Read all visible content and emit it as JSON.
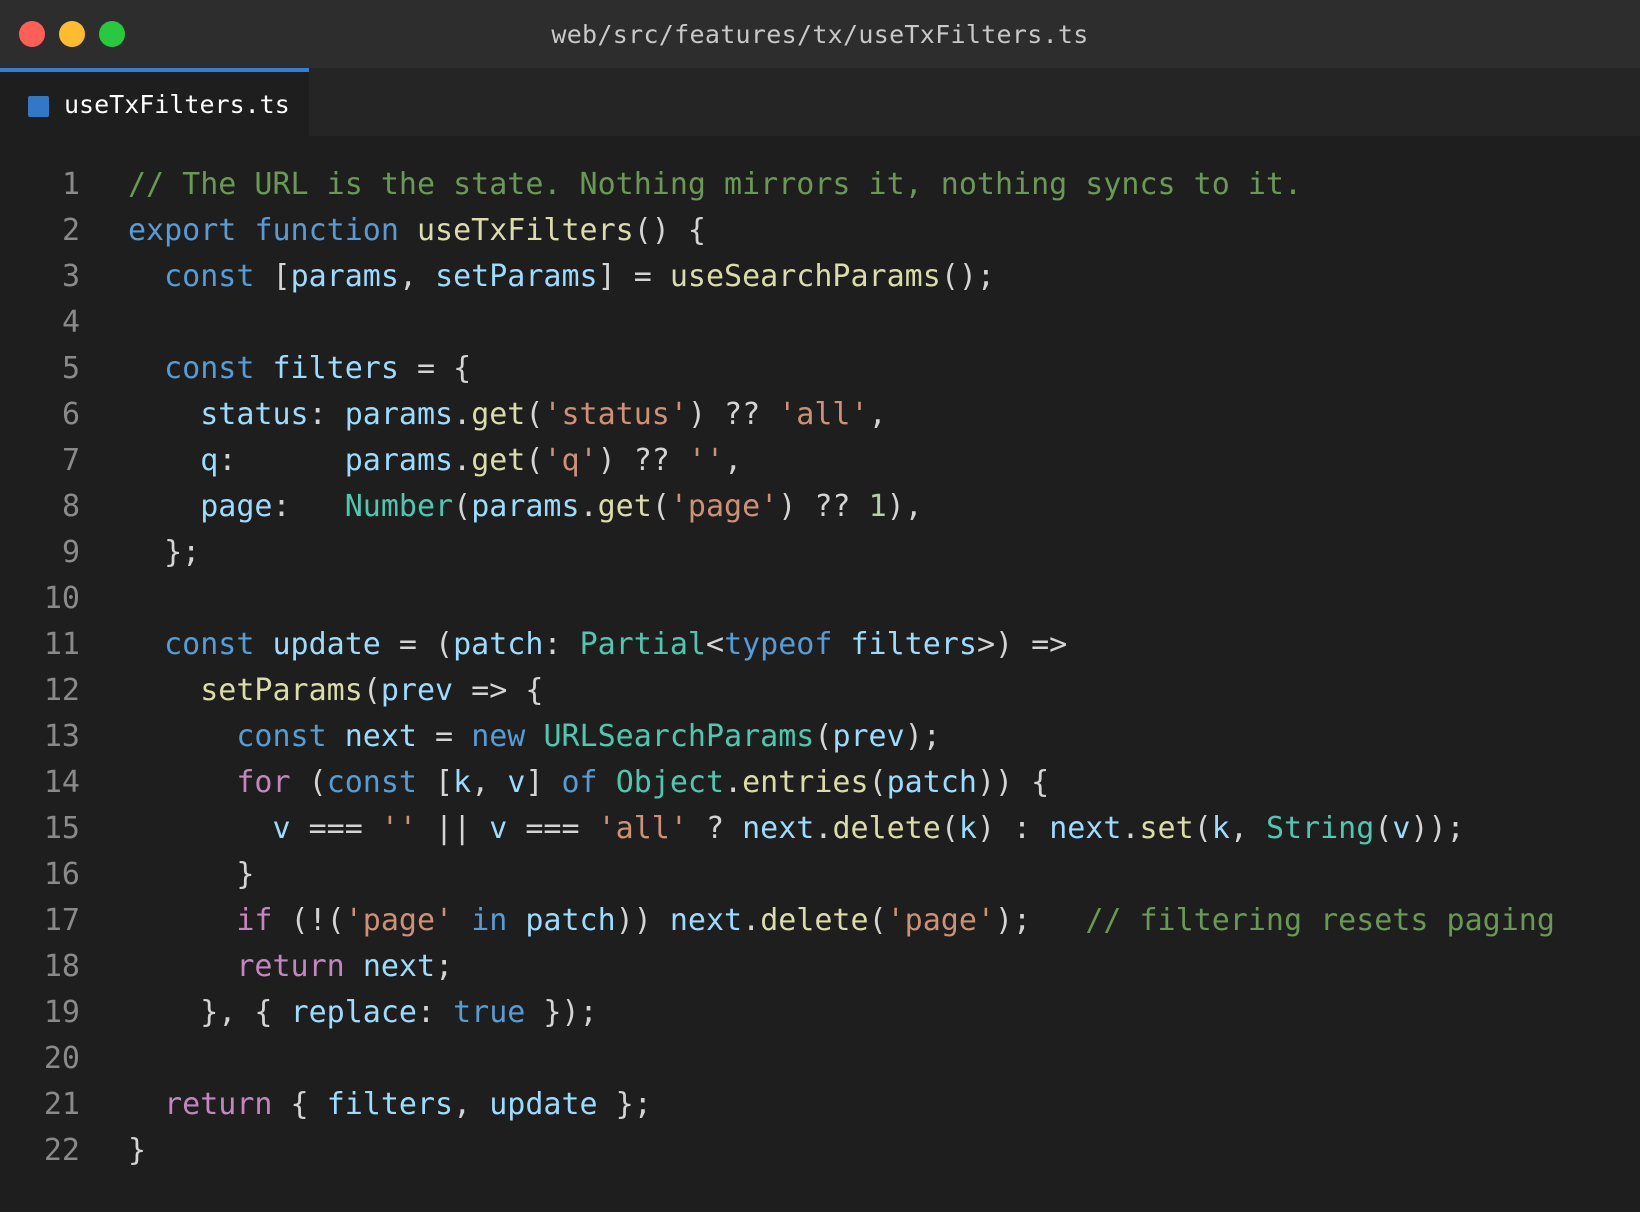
{
  "window": {
    "title": "web/src/features/tx/useTxFilters.ts"
  },
  "tabs": [
    {
      "label": "useTxFilters.ts",
      "icon": "typescript-file-icon",
      "active": true
    }
  ],
  "colors": {
    "keyword": "#569cd6",
    "control": "#c586c0",
    "function": "#dcdcaa",
    "variable": "#9cdcfe",
    "type": "#4ec9b0",
    "string": "#ce9178",
    "number": "#b5cea8",
    "comment": "#6a9955",
    "tab_accent": "#2f7fd8"
  },
  "editor": {
    "lines": [
      {
        "n": "1",
        "tokens": [
          [
            "cmt",
            "// The URL is the state. Nothing mirrors it, nothing syncs to it."
          ]
        ]
      },
      {
        "n": "2",
        "tokens": [
          [
            "kw",
            "export"
          ],
          [
            "pun",
            " "
          ],
          [
            "kw",
            "function"
          ],
          [
            "pun",
            " "
          ],
          [
            "fn",
            "useTxFilters"
          ],
          [
            "pun",
            "() {"
          ]
        ]
      },
      {
        "n": "3",
        "tokens": [
          [
            "pun",
            "  "
          ],
          [
            "kw",
            "const"
          ],
          [
            "pun",
            " ["
          ],
          [
            "var",
            "params"
          ],
          [
            "pun",
            ", "
          ],
          [
            "var",
            "setParams"
          ],
          [
            "pun",
            "] = "
          ],
          [
            "fn",
            "useSearchParams"
          ],
          [
            "pun",
            "();"
          ]
        ]
      },
      {
        "n": "4",
        "tokens": []
      },
      {
        "n": "5",
        "tokens": [
          [
            "pun",
            "  "
          ],
          [
            "kw",
            "const"
          ],
          [
            "pun",
            " "
          ],
          [
            "var",
            "filters"
          ],
          [
            "pun",
            " = {"
          ]
        ]
      },
      {
        "n": "6",
        "tokens": [
          [
            "pun",
            "    "
          ],
          [
            "var",
            "status"
          ],
          [
            "pun",
            ": "
          ],
          [
            "var",
            "params"
          ],
          [
            "pun",
            "."
          ],
          [
            "fn",
            "get"
          ],
          [
            "pun",
            "("
          ],
          [
            "str",
            "'status'"
          ],
          [
            "pun",
            ") ?? "
          ],
          [
            "str",
            "'all'"
          ],
          [
            "pun",
            ","
          ]
        ]
      },
      {
        "n": "7",
        "tokens": [
          [
            "pun",
            "    "
          ],
          [
            "var",
            "q"
          ],
          [
            "pun",
            ":      "
          ],
          [
            "var",
            "params"
          ],
          [
            "pun",
            "."
          ],
          [
            "fn",
            "get"
          ],
          [
            "pun",
            "("
          ],
          [
            "str",
            "'q'"
          ],
          [
            "pun",
            ") ?? "
          ],
          [
            "str",
            "''"
          ],
          [
            "pun",
            ","
          ]
        ]
      },
      {
        "n": "8",
        "tokens": [
          [
            "pun",
            "    "
          ],
          [
            "var",
            "page"
          ],
          [
            "pun",
            ":   "
          ],
          [
            "type",
            "Number"
          ],
          [
            "pun",
            "("
          ],
          [
            "var",
            "params"
          ],
          [
            "pun",
            "."
          ],
          [
            "fn",
            "get"
          ],
          [
            "pun",
            "("
          ],
          [
            "str",
            "'page'"
          ],
          [
            "pun",
            ") ?? "
          ],
          [
            "num",
            "1"
          ],
          [
            "pun",
            "),"
          ]
        ]
      },
      {
        "n": "9",
        "tokens": [
          [
            "pun",
            "  };"
          ]
        ]
      },
      {
        "n": "10",
        "tokens": []
      },
      {
        "n": "11",
        "tokens": [
          [
            "pun",
            "  "
          ],
          [
            "kw",
            "const"
          ],
          [
            "pun",
            " "
          ],
          [
            "var",
            "update"
          ],
          [
            "pun",
            " = ("
          ],
          [
            "var",
            "patch"
          ],
          [
            "pun",
            ": "
          ],
          [
            "type",
            "Partial"
          ],
          [
            "pun",
            "<"
          ],
          [
            "kw",
            "typeof"
          ],
          [
            "pun",
            " "
          ],
          [
            "var",
            "filters"
          ],
          [
            "pun",
            ">) =>"
          ]
        ]
      },
      {
        "n": "12",
        "tokens": [
          [
            "pun",
            "    "
          ],
          [
            "fn",
            "setParams"
          ],
          [
            "pun",
            "("
          ],
          [
            "var",
            "prev"
          ],
          [
            "pun",
            " => {"
          ]
        ]
      },
      {
        "n": "13",
        "tokens": [
          [
            "pun",
            "      "
          ],
          [
            "kw",
            "const"
          ],
          [
            "pun",
            " "
          ],
          [
            "var",
            "next"
          ],
          [
            "pun",
            " = "
          ],
          [
            "kw",
            "new"
          ],
          [
            "pun",
            " "
          ],
          [
            "type",
            "URLSearchParams"
          ],
          [
            "pun",
            "("
          ],
          [
            "var",
            "prev"
          ],
          [
            "pun",
            ");"
          ]
        ]
      },
      {
        "n": "14",
        "tokens": [
          [
            "pun",
            "      "
          ],
          [
            "ctrl",
            "for"
          ],
          [
            "pun",
            " ("
          ],
          [
            "kw",
            "const"
          ],
          [
            "pun",
            " ["
          ],
          [
            "var",
            "k"
          ],
          [
            "pun",
            ", "
          ],
          [
            "var",
            "v"
          ],
          [
            "pun",
            "] "
          ],
          [
            "kw",
            "of"
          ],
          [
            "pun",
            " "
          ],
          [
            "type",
            "Object"
          ],
          [
            "pun",
            "."
          ],
          [
            "fn",
            "entries"
          ],
          [
            "pun",
            "("
          ],
          [
            "var",
            "patch"
          ],
          [
            "pun",
            ")) {"
          ]
        ]
      },
      {
        "n": "15",
        "tokens": [
          [
            "pun",
            "        "
          ],
          [
            "var",
            "v"
          ],
          [
            "pun",
            " === "
          ],
          [
            "str",
            "''"
          ],
          [
            "pun",
            " || "
          ],
          [
            "var",
            "v"
          ],
          [
            "pun",
            " === "
          ],
          [
            "str",
            "'all'"
          ],
          [
            "pun",
            " ? "
          ],
          [
            "var",
            "next"
          ],
          [
            "pun",
            "."
          ],
          [
            "fn",
            "delete"
          ],
          [
            "pun",
            "("
          ],
          [
            "var",
            "k"
          ],
          [
            "pun",
            ") : "
          ],
          [
            "var",
            "next"
          ],
          [
            "pun",
            "."
          ],
          [
            "fn",
            "set"
          ],
          [
            "pun",
            "("
          ],
          [
            "var",
            "k"
          ],
          [
            "pun",
            ", "
          ],
          [
            "type",
            "String"
          ],
          [
            "pun",
            "("
          ],
          [
            "var",
            "v"
          ],
          [
            "pun",
            "));"
          ]
        ]
      },
      {
        "n": "16",
        "tokens": [
          [
            "pun",
            "      }"
          ]
        ]
      },
      {
        "n": "17",
        "tokens": [
          [
            "pun",
            "      "
          ],
          [
            "ctrl",
            "if"
          ],
          [
            "pun",
            " (!("
          ],
          [
            "str",
            "'page'"
          ],
          [
            "pun",
            " "
          ],
          [
            "kw",
            "in"
          ],
          [
            "pun",
            " "
          ],
          [
            "var",
            "patch"
          ],
          [
            "pun",
            ")) "
          ],
          [
            "var",
            "next"
          ],
          [
            "pun",
            "."
          ],
          [
            "fn",
            "delete"
          ],
          [
            "pun",
            "("
          ],
          [
            "str",
            "'page'"
          ],
          [
            "pun",
            ");   "
          ],
          [
            "cmt",
            "// filtering resets paging"
          ]
        ]
      },
      {
        "n": "18",
        "tokens": [
          [
            "pun",
            "      "
          ],
          [
            "ctrl",
            "return"
          ],
          [
            "pun",
            " "
          ],
          [
            "var",
            "next"
          ],
          [
            "pun",
            ";"
          ]
        ]
      },
      {
        "n": "19",
        "tokens": [
          [
            "pun",
            "    }, { "
          ],
          [
            "var",
            "replace"
          ],
          [
            "pun",
            ": "
          ],
          [
            "kw",
            "true"
          ],
          [
            "pun",
            " });"
          ]
        ]
      },
      {
        "n": "20",
        "tokens": []
      },
      {
        "n": "21",
        "tokens": [
          [
            "pun",
            "  "
          ],
          [
            "ctrl",
            "return"
          ],
          [
            "pun",
            " { "
          ],
          [
            "var",
            "filters"
          ],
          [
            "pun",
            ", "
          ],
          [
            "var",
            "update"
          ],
          [
            "pun",
            " };"
          ]
        ]
      },
      {
        "n": "22",
        "tokens": [
          [
            "pun",
            "}"
          ]
        ]
      }
    ]
  }
}
